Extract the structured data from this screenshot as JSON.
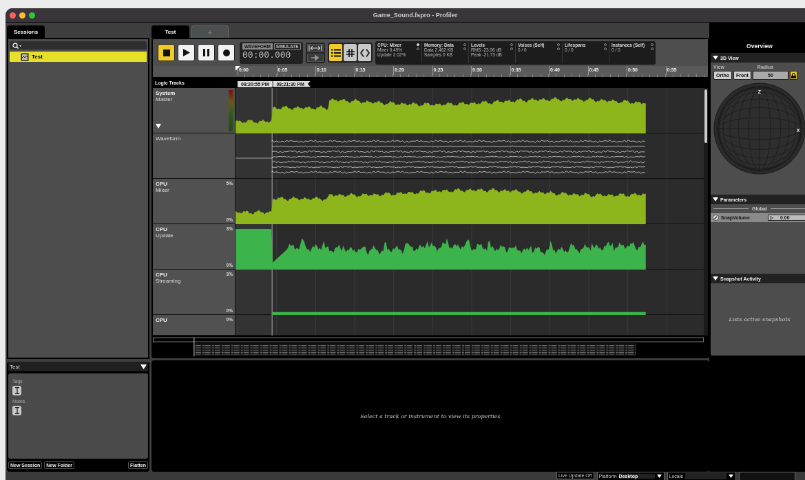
{
  "window": {
    "title": "Game_Sound.fspro - Profiler"
  },
  "sessions": {
    "tab": "Sessions",
    "items": [
      {
        "label": "Test",
        "selected": true
      }
    ]
  },
  "session_panel": {
    "title": "Test",
    "tags_label": "Tags",
    "notes_label": "Notes",
    "buttons": [
      "New Session",
      "New Folder",
      "Flatten"
    ]
  },
  "document_tabs": [
    {
      "label": "Test",
      "selected": true
    },
    {
      "label": "+",
      "selected": false
    }
  ],
  "transport": [
    {
      "kind": "stop",
      "selected": true
    },
    {
      "kind": "play",
      "selected": false
    },
    {
      "kind": "pause",
      "selected": false
    },
    {
      "kind": "record",
      "selected": false
    }
  ],
  "display": {
    "modes": [
      {
        "label": "WAVEFORM",
        "selected": true
      },
      {
        "label": "SIMULATE",
        "selected": false
      }
    ],
    "time": "00:00.000"
  },
  "view_buttons": [
    {
      "kind": "list",
      "selected": true
    },
    {
      "kind": "grid",
      "selected": false
    },
    {
      "kind": "code",
      "selected": false
    }
  ],
  "stats": [
    {
      "title": "CPU: Mixer",
      "lines": [
        "Mixer 0.49%",
        "Update 2.02%"
      ],
      "live": true
    },
    {
      "title": "Memory: Data",
      "lines": [
        "Data 2,462 KB",
        "Samples 0 KB"
      ],
      "live": false
    },
    {
      "title": "Levels",
      "lines": [
        "RMS -23.06 dB",
        "Peak -21.73 dB"
      ],
      "live": false
    },
    {
      "title": "Voices (Self)",
      "lines": [
        "0 / 0"
      ],
      "live": false
    },
    {
      "title": "Lifespans",
      "lines": [
        "0 / 0"
      ],
      "live": false
    },
    {
      "title": "Instances (Self)",
      "lines": [
        "0 / 0"
      ],
      "live": false
    }
  ],
  "ruler": {
    "ticks": [
      "0:00",
      "0:05",
      "0:10",
      "0:15",
      "0:20",
      "0:25",
      "0:30",
      "0:35",
      "0:40",
      "0:45",
      "0:50",
      "0:55"
    ]
  },
  "logic_tracks": {
    "label": "Logic Tracks",
    "markers": [
      "08:20:55 PM",
      "08:21:30 PM"
    ]
  },
  "tracks": [
    {
      "kind": "meter",
      "category": "System",
      "name": "Master",
      "level": 0,
      "expanded": true,
      "color": "#8cb61c"
    },
    {
      "kind": "waveform",
      "name": "Waveform"
    },
    {
      "kind": "cpu",
      "category": "CPU",
      "name": "Mixer",
      "max": "5%",
      "min": "0%",
      "color": "#8cb61c"
    },
    {
      "kind": "cpu",
      "category": "CPU",
      "name": "Update",
      "max": "3%",
      "min": "0%",
      "color": "#3cb44b"
    },
    {
      "kind": "cpu",
      "category": "CPU",
      "name": "Streaming",
      "max": "3%",
      "min": "0%",
      "color": "#3cb44b"
    },
    {
      "kind": "cpu",
      "category": "CPU",
      "max": "0%"
    }
  ],
  "properties": {
    "hint": "Select a track or instrument to view its properties"
  },
  "overview": {
    "title": "Overview",
    "view3d": {
      "title": "3D View",
      "view_label": "View",
      "radius_label": "Radius",
      "buttons": [
        "Ortho",
        "Front"
      ],
      "radius": "50",
      "locked": true,
      "axes": [
        "Z",
        "X"
      ]
    },
    "parameters": {
      "title": "Parameters",
      "group": "Global",
      "items": [
        {
          "name": "SnapVolume",
          "value": "0.00"
        }
      ]
    },
    "snapshots": {
      "title": "Snapshot Activity",
      "hint": "Lists active snapshots"
    }
  },
  "status_bar": {
    "live_update": "Live Update Off",
    "platform_label": "Platform",
    "platform": "Desktop",
    "locale_label": "Locale"
  }
}
